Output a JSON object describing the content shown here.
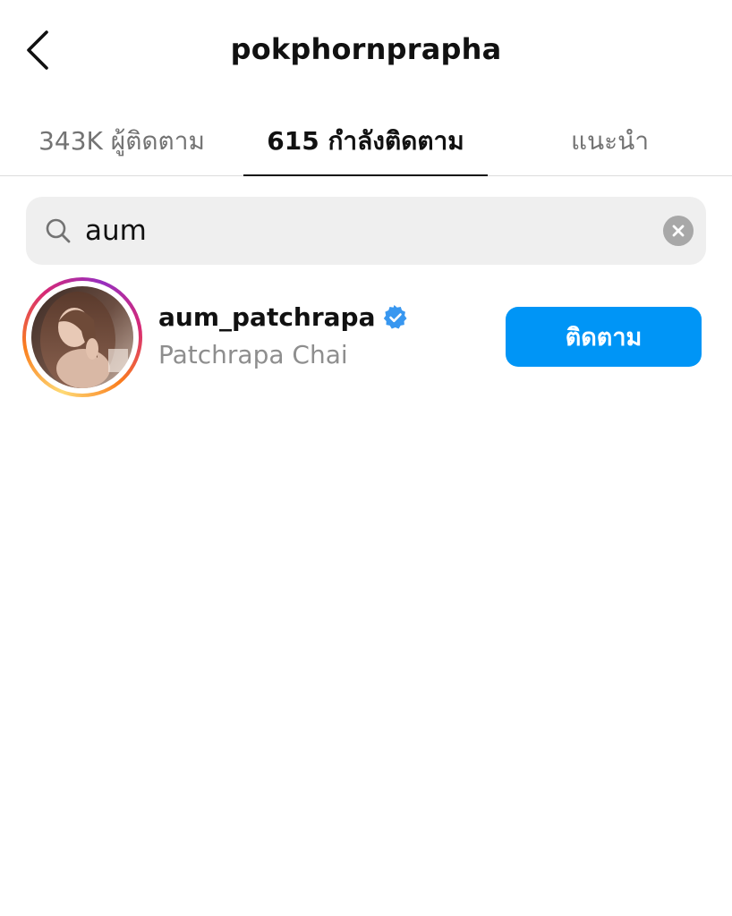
{
  "header": {
    "title": "pokphornprapha",
    "back_icon": "chevron-left-icon"
  },
  "tabs": [
    {
      "label": "343K ผู้ติดตาม",
      "active": false
    },
    {
      "label": "615 กำลังติดตาม",
      "active": true
    },
    {
      "label": "แนะนำ",
      "active": false
    }
  ],
  "search": {
    "value": "aum",
    "icon": "search-icon",
    "clear_icon": "clear-icon"
  },
  "results": [
    {
      "username": "aum_patchrapa",
      "full_name": "Patchrapa Chai",
      "verified": true,
      "has_story": true,
      "follow_label": "ติดตาม"
    }
  ],
  "colors": {
    "accent": "#0095f6",
    "verified": "#3897f0",
    "text_primary": "#111111",
    "text_secondary": "#737373",
    "search_bg": "#efefef"
  }
}
